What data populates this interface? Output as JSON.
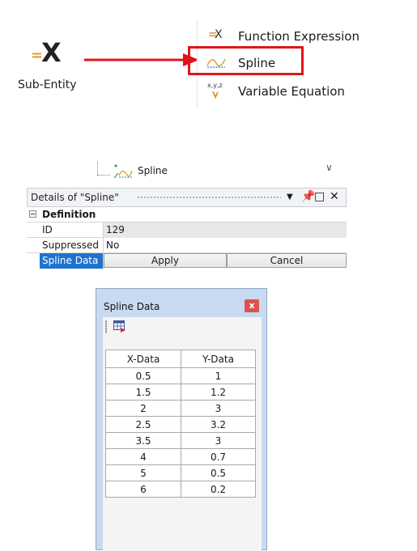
{
  "subentity": {
    "label": "Sub-Entity",
    "glyph_eq": "=",
    "glyph_x": "X"
  },
  "dropdown": {
    "items": [
      {
        "label": "Function Expression",
        "icon": "function-expression-icon"
      },
      {
        "label": "Spline",
        "icon": "spline-icon"
      },
      {
        "label": "Variable Equation",
        "icon": "variable-equation-icon"
      }
    ],
    "icon_text_fx": "=X",
    "icon_text_xyz": "x,y,z"
  },
  "tree": {
    "label": "Spline"
  },
  "details": {
    "title": "Details of \"Spline\"",
    "section": "Definition",
    "rows": [
      {
        "key": "ID",
        "value": "129"
      },
      {
        "key": "Suppressed",
        "value": "No"
      },
      {
        "key": "Spline Data",
        "apply": "Apply",
        "cancel": "Cancel"
      }
    ]
  },
  "dialog": {
    "title": "Spline Data",
    "close": "x",
    "columns": [
      "X-Data",
      "Y-Data"
    ],
    "rows": [
      [
        "0.5",
        "1"
      ],
      [
        "1.5",
        "1.2"
      ],
      [
        "2",
        "3"
      ],
      [
        "2.5",
        "3.2"
      ],
      [
        "3.5",
        "3"
      ],
      [
        "4",
        "0.7"
      ],
      [
        "5",
        "0.5"
      ],
      [
        "6",
        "0.2"
      ]
    ]
  },
  "colors": {
    "highlight": "#e0141a",
    "accent_blue": "#1e73cf",
    "dialog_bg": "#c9daf0"
  }
}
